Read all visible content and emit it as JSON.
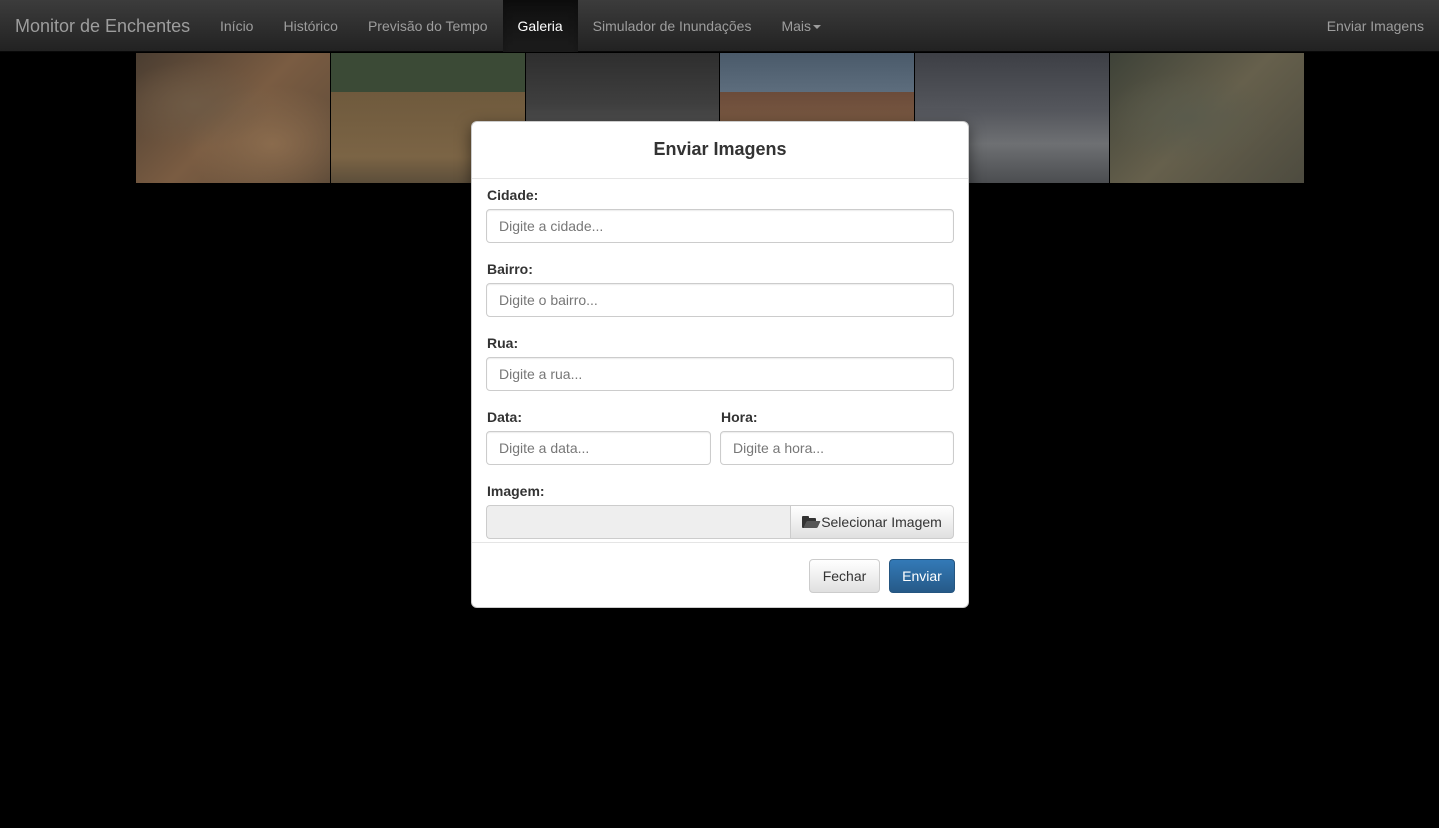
{
  "navbar": {
    "brand": "Monitor de Enchentes",
    "items": [
      {
        "label": "Início",
        "active": false
      },
      {
        "label": "Histórico",
        "active": false
      },
      {
        "label": "Previsão do Tempo",
        "active": false
      },
      {
        "label": "Galeria",
        "active": true
      },
      {
        "label": "Simulador de Inundações",
        "active": false
      },
      {
        "label": "Mais",
        "active": false
      }
    ],
    "right_item": "Enviar Imagens"
  },
  "gallery": {
    "thumbnails": [
      {
        "name": "aerial-flooded-town"
      },
      {
        "name": "flooded-river-bridge"
      },
      {
        "name": "street-crowd-vehicles"
      },
      {
        "name": "flooded-building"
      },
      {
        "name": "car-splashing-water"
      },
      {
        "name": "aerial-flooded-neighborhood"
      }
    ]
  },
  "modal": {
    "title": "Enviar Imagens",
    "fields": {
      "cidade": {
        "label": "Cidade:",
        "placeholder": "Digite a cidade...",
        "value": ""
      },
      "bairro": {
        "label": "Bairro:",
        "placeholder": "Digite o bairro...",
        "value": ""
      },
      "rua": {
        "label": "Rua:",
        "placeholder": "Digite a rua...",
        "value": ""
      },
      "data": {
        "label": "Data:",
        "placeholder": "Digite a data...",
        "value": ""
      },
      "hora": {
        "label": "Hora:",
        "placeholder": "Digite a hora...",
        "value": ""
      },
      "imagem": {
        "label": "Imagem:",
        "value": "",
        "button_label": "Selecionar Imagem",
        "button_icon": "folder-open-icon"
      }
    },
    "footer": {
      "close_label": "Fechar",
      "submit_label": "Enviar"
    }
  },
  "colors": {
    "navbar_background": "#222222",
    "primary_button": "#337ab7",
    "overlay": "#000000"
  }
}
